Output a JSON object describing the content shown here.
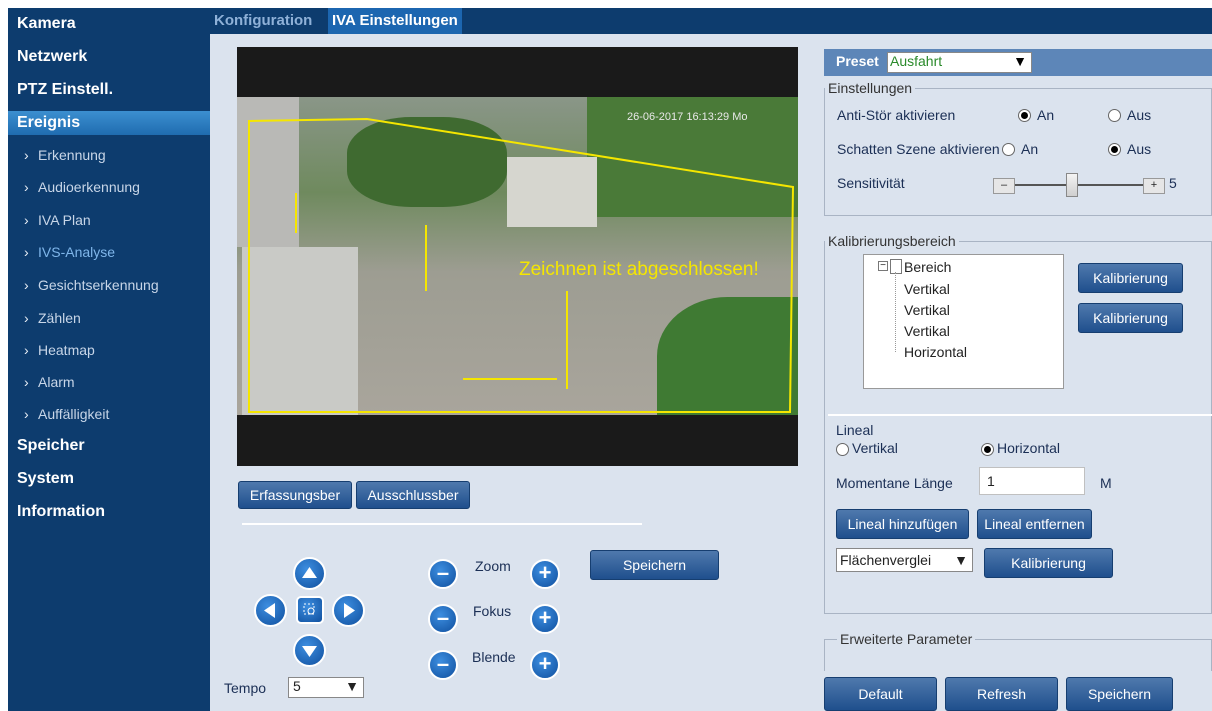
{
  "sidebar": {
    "items": [
      {
        "label": "Kamera"
      },
      {
        "label": "Netzwerk"
      },
      {
        "label": "PTZ Einstell."
      },
      {
        "label": "Ereignis"
      },
      {
        "label": "Erkennung"
      },
      {
        "label": "Audioerkennung"
      },
      {
        "label": "IVA Plan"
      },
      {
        "label": "IVS-Analyse"
      },
      {
        "label": "Gesichtserkennung"
      },
      {
        "label": "Zählen"
      },
      {
        "label": "Heatmap"
      },
      {
        "label": "Alarm"
      },
      {
        "label": "Auffälligkeit"
      },
      {
        "label": "Speicher"
      },
      {
        "label": "System"
      },
      {
        "label": "Information"
      }
    ]
  },
  "tabs": {
    "config": "Konfiguration",
    "iva": "IVA Einstellungen"
  },
  "video": {
    "timestamp": "26-06-2017 16:13:29 Mo",
    "overlay_text": "Zeichnen ist abgeschlossen!"
  },
  "buttons": {
    "erfassung": "Erfassungsber",
    "ausschluss": "Ausschlussber",
    "speichern": "Speichern"
  },
  "ptz": {
    "zoom": "Zoom",
    "fokus": "Fokus",
    "blende": "Blende",
    "tempo_label": "Tempo",
    "tempo_value": "5"
  },
  "preset": {
    "label": "Preset",
    "value": "Ausfahrt"
  },
  "einstellungen": {
    "legend": "Einstellungen",
    "anti_label": "Anti-Stör aktivieren",
    "schatten_label": "Schatten Szene aktivieren",
    "an": "An",
    "aus": "Aus",
    "sens_label": "Sensitivität",
    "sens_value": "5",
    "sens_level": 5
  },
  "kalib": {
    "legend": "Kalibrierungsbereich",
    "tree_root": "Bereich",
    "tree_items": [
      "Vertikal",
      "Vertikal",
      "Vertikal",
      "Horizontal"
    ],
    "btn": "Kalibrierung"
  },
  "lineal": {
    "label": "Lineal",
    "vertikal": "Vertikal",
    "horizontal": "Horizontal",
    "laenge_label": "Momentane Länge",
    "laenge_value": "1",
    "unit": "M",
    "add_btn": "Lineal hinzufügen",
    "remove_btn": "Lineal entfernen",
    "select_value": "Flächenverglei",
    "kalib_btn": "Kalibrierung"
  },
  "erweitert": {
    "legend": "Erweiterte Parameter"
  },
  "bottom": {
    "default": "Default",
    "refresh": "Refresh",
    "speichern": "Speichern"
  }
}
